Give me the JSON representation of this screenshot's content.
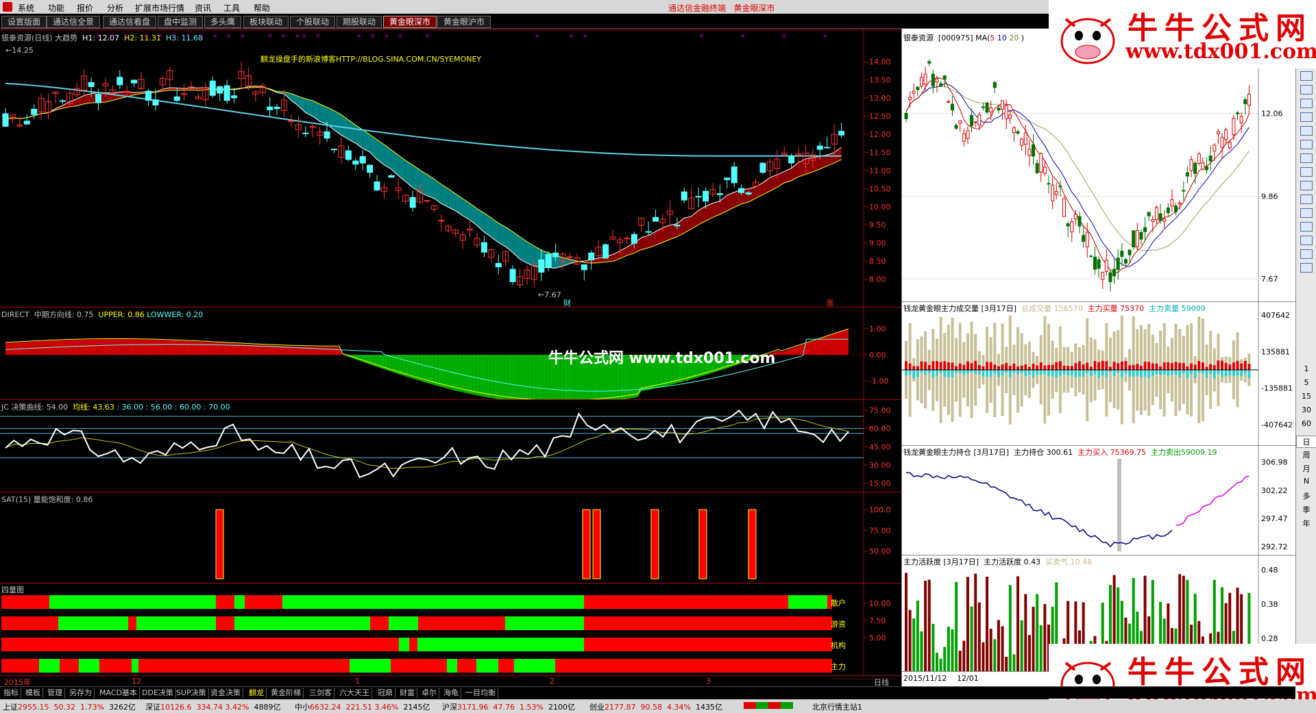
{
  "menu": {
    "items": [
      "系统",
      "功能",
      "报价",
      "分析",
      "扩展市场行情",
      "资讯",
      "工具",
      "帮助"
    ],
    "center_title": "通达信金融终端",
    "center_sub": "黄金眼深市"
  },
  "tabs": [
    "设置版面",
    "通达信全景",
    "通达信看盘",
    "盘中监测",
    "多头鹰",
    "板块联动",
    "个股联动",
    "期股联动",
    "黄金眼深市",
    "黄金眼沪市"
  ],
  "active_tab": "黄金眼深市",
  "main": {
    "stock_line": "银泰资源(日线) 大趋势",
    "h1": "H1: 12.07",
    "h2": "H2: 11.31",
    "h3": "H3: 11.68",
    "high_label": "14.25",
    "low_label": "7.67",
    "blog_text": "麒龙操盘手的新浪博客HTTP://BLOG.SINA.COM.CN/SYEMONEY",
    "cai": "财",
    "zhang": "涨",
    "yaxis": [
      "14.00",
      "13.50",
      "13.00",
      "12.50",
      "12.00",
      "11.50",
      "11.00",
      "10.50",
      "10.00",
      "9.50",
      "9.00",
      "8.50",
      "8.00"
    ]
  },
  "direct": {
    "name": "DIRECT",
    "label": "中期方向线: 0.75",
    "upper": "UPPER: 0.86",
    "lower": "LOWWER: 0.20",
    "yaxis": [
      "1.00",
      "0.00",
      "-1.00"
    ]
  },
  "jc": {
    "name": "JC",
    "label": "决策曲线: 54.00",
    "avg": "均线: 43.63",
    "levels": ": 36.00 : 56.00 : 60.00 : 70.00",
    "yaxis": [
      "75.00",
      "60.00",
      "45.00",
      "30.00",
      "15.00"
    ]
  },
  "sat": {
    "name": "SAT(15)",
    "label": "量能饱和度: 0.86",
    "yaxis": [
      "100.0",
      "75.00",
      "50.00"
    ]
  },
  "four": {
    "title": "四量图",
    "rows": [
      "散户",
      "游资",
      "机构",
      "主力"
    ],
    "yaxis": [
      "10.00",
      "7.50",
      "5.00"
    ]
  },
  "xaxis": {
    "labels": [
      "2015年",
      "12",
      "1",
      "2",
      "3"
    ],
    "period": "日线"
  },
  "right": {
    "kline_title": "银泰资源",
    "code": "[000975]",
    "ma": "MA(",
    "ma5": "5",
    "ma10": "10",
    "ma20": "20",
    "ma_close": ")",
    "kline_y": [
      "12.06",
      "9.86",
      "7.67"
    ],
    "vol_title": "钱龙黄金眼主力成交量 [3月17日]",
    "vol_total": "总成交量 156570",
    "vol_buy": "主力买量 75370",
    "vol_sell": "主力卖量 59009",
    "vol_y": [
      "407642",
      "135881",
      "-135881",
      "-407642"
    ],
    "hold_title": "钱龙黄金眼主力持仓 [3月17日]",
    "hold_val": "主力持仓 300.61",
    "hold_buy": "主力买入 75369.75",
    "hold_sell": "主力卖出59009.19",
    "hold_y": [
      "306.98",
      "302.22",
      "297.47",
      "292.72"
    ],
    "act_title": "主力活跃度 [3月17日]",
    "act_val": "主力活跃度 0.43",
    "act_qi": "买卖气 10.48",
    "act_y": [
      "0.48",
      "0.38",
      "0.28"
    ],
    "date_labels": [
      "2015/11/12",
      "12/01"
    ]
  },
  "watermark": {
    "title": "牛牛公式网",
    "url": "www.tdx001.com",
    "center": "牛牛公式网 www.tdx001.com"
  },
  "side_chars": [
    "1",
    "5",
    "15",
    "30",
    "60",
    "日",
    "周",
    "月",
    "N",
    "多",
    "季",
    "年"
  ],
  "bottom_tabs": [
    "指标",
    "模板",
    "管理",
    "另存为",
    "MACD基本",
    "DDE决策",
    "SUP决策",
    "资金决策",
    "麒龙",
    "黄金阶梯",
    "三剑客",
    "六大天王",
    "冠鼎",
    "财富",
    "卓尔",
    "海龟",
    "一目均衡"
  ],
  "bottom_selected": "麒龙",
  "status": {
    "sh": "上证",
    "sh_v": "2955.15",
    "sh_c": "50.32",
    "sh_p": "1.73%",
    "sh_a": "3262亿",
    "sz": "深证",
    "sz_v": "10126.6",
    "sz_c": "334.74",
    "sz_p": "3.42%",
    "sz_a": "4889亿",
    "zx": "中小",
    "zx_v": "6632.24",
    "zx_c": "221.51",
    "zx_p": "3.46%",
    "zx_a": "2145亿",
    "hs": "沪深",
    "hs_v": "3171.96",
    "hs_c": "47.76",
    "hs_p": "1.53%",
    "hs_a": "2100亿",
    "cy": "创业",
    "cy_v": "2177.87",
    "cy_c": "90.58",
    "cy_p": "4.34%",
    "cy_a": "1435亿",
    "server": "北京行情主站1"
  },
  "colors": {
    "up": "#ff3030",
    "down": "#54ffff",
    "ma_long": "#5ad2e6",
    "bull_fill": "#8a0000",
    "bear_fill": "#008080",
    "green": "#00ff00",
    "red": "#ff0000"
  }
}
